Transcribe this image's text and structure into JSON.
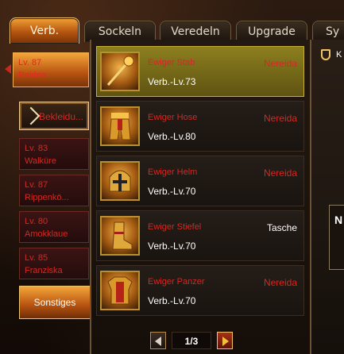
{
  "tabs": [
    {
      "label": "Verb.",
      "active": true
    },
    {
      "label": "Sockeln",
      "active": false
    },
    {
      "label": "Veredeln",
      "active": false
    },
    {
      "label": "Upgrade",
      "active": false
    },
    {
      "label": "Sy",
      "active": false
    }
  ],
  "characters": [
    {
      "level": "Lv. 87",
      "name": "Raiden",
      "selected": true
    },
    {
      "level": "Lv. 83",
      "name": "Walküre",
      "selected": false
    },
    {
      "level": "Lv. 87",
      "name": "Rippenkö...",
      "selected": false
    },
    {
      "level": "Lv. 80",
      "name": "Amokklaue",
      "selected": false
    },
    {
      "level": "Lv. 85",
      "name": "Franziska",
      "selected": false
    }
  ],
  "equip_button": {
    "label": "Bekleidu..."
  },
  "misc_button": {
    "label": "Sonstiges"
  },
  "items": [
    {
      "name": "Ewiger Stab",
      "level": "Verb.-Lv.73",
      "owner": "Nereida",
      "icon": "staff-icon",
      "selected": true
    },
    {
      "name": "Ewiger Hose",
      "level": "Verb.-Lv.80",
      "owner": "Nereida",
      "icon": "pants-icon",
      "selected": false
    },
    {
      "name": "Ewiger Helm",
      "level": "Verb.-Lv.70",
      "owner": "Nereida",
      "icon": "helmet-icon",
      "selected": false
    },
    {
      "name": "Ewiger Stiefel",
      "level": "Verb.-Lv.70",
      "owner": "Tasche",
      "icon": "boots-icon",
      "selected": false
    },
    {
      "name": "Ewiger Panzer",
      "level": "Verb.-Lv.70",
      "owner": "Nereida",
      "icon": "armor-icon",
      "selected": false
    }
  ],
  "pager": {
    "label": "1/3"
  },
  "right": {
    "header_fragment": "K",
    "box_fragment": "N"
  },
  "colors": {
    "accent_orange": "#e98a24",
    "name_red": "#cf2a25",
    "selected_olive": "#8c7f1f"
  }
}
